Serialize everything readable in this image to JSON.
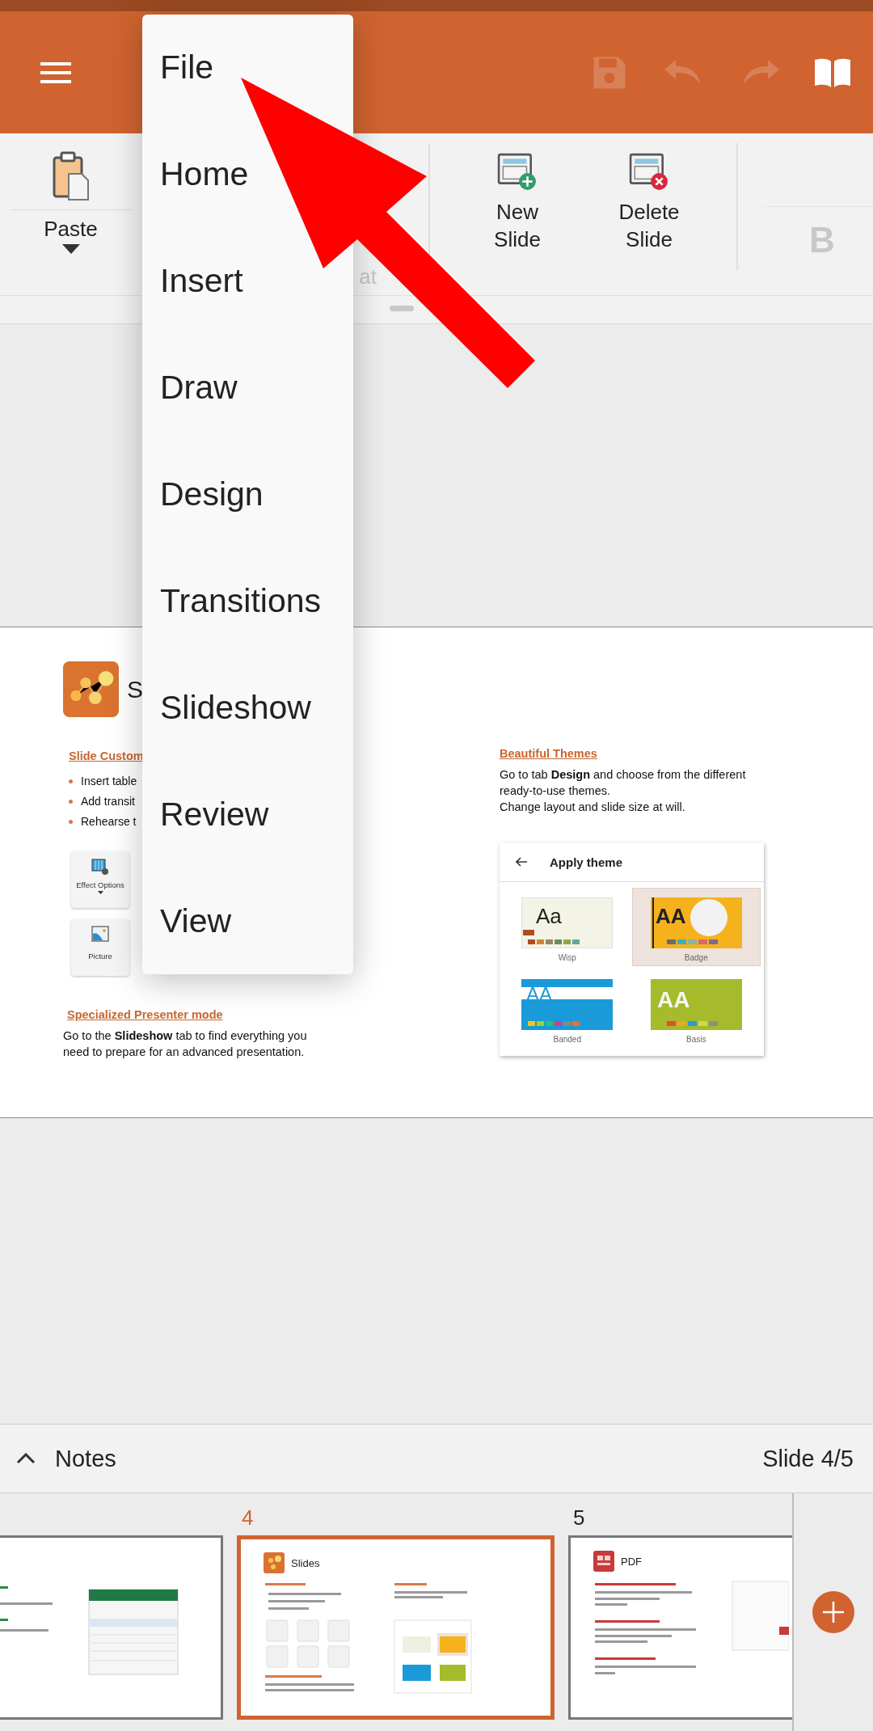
{
  "app_bar": {
    "actions": [
      {
        "kind": "save",
        "disabled": true
      },
      {
        "kind": "undo",
        "disabled": true
      },
      {
        "kind": "redo",
        "disabled": true
      },
      {
        "kind": "book",
        "disabled": false
      }
    ]
  },
  "ribbon": {
    "paste": {
      "label": "Paste"
    },
    "hidden_label": "at",
    "slide_actions": [
      {
        "kind": "new",
        "label": "New Slide"
      },
      {
        "kind": "delete",
        "label": "Delete Slide"
      }
    ],
    "bold": {
      "label": "B",
      "disabled": true
    }
  },
  "menu": {
    "items": [
      {
        "label": "File"
      },
      {
        "label": "Home"
      },
      {
        "label": "Insert"
      },
      {
        "label": "Draw"
      },
      {
        "label": "Design"
      },
      {
        "label": "Transitions"
      },
      {
        "label": "Slideshow"
      },
      {
        "label": "Review"
      },
      {
        "label": "View"
      }
    ]
  },
  "slide": {
    "title": "S",
    "left": {
      "heading": "Slide Custom",
      "bullets": [
        "Insert table",
        "Add transit",
        "Rehearse t"
      ],
      "tools": [
        {
          "kind": "effect",
          "label": "Effect Options"
        },
        {
          "kind": "picture",
          "label": "Picture"
        }
      ],
      "heading_2": "Specialized Presenter mode",
      "text": "Go to the **Slideshow** tab to find everything you need to prepare for an advanced presentation."
    },
    "right": {
      "heading": "Beautiful Themes",
      "text": "Go to tab **Design** and choose from the different ready-to-use themes.",
      "text_2": "Change layout and slide size at will.",
      "theme_panel": {
        "title": "Apply theme",
        "themes": [
          {
            "kind": "wisp",
            "sample": "Aa",
            "name": "Wisp",
            "selected": false
          },
          {
            "kind": "badge",
            "sample": "AA",
            "name": "Badge",
            "selected": true
          },
          {
            "kind": "banded",
            "sample": "AA",
            "name": "Banded",
            "selected": false
          },
          {
            "kind": "basis",
            "sample": "AA",
            "name": "Basis",
            "selected": false
          }
        ]
      }
    }
  },
  "notes_bar": {
    "label": "Notes",
    "expanded": false,
    "slide_counter": "Slide 4/5"
  },
  "thumbnails": [
    {
      "kind": "sheet",
      "selected": false
    },
    {
      "kind": "slides",
      "number": "4",
      "title": "Slides",
      "selected": true
    },
    {
      "kind": "pdf",
      "number": "5",
      "title": "PDF",
      "selected": false
    }
  ]
}
